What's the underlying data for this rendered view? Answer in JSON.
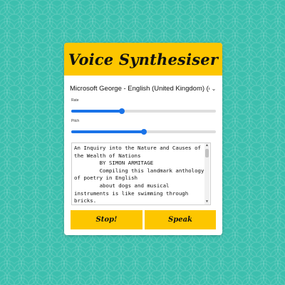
{
  "app": {
    "title": "Voice Synthesiser"
  },
  "voice": {
    "selected": "Microsoft George - English (United Kingdom) (en-GB)"
  },
  "rate": {
    "label": "Rate",
    "level": 0.35
  },
  "pitch": {
    "label": "Pitch",
    "level": 0.5
  },
  "text_input": {
    "value": "An Inquiry into the Nature and Causes of the Wealth of Nations\n        BY SIMON ARMITAGE\n        Compiling this landmark anthology of poetry in English\n        about dogs and musical instruments is like swimming through bricks."
  },
  "buttons": {
    "stop": "Stop!",
    "speak": "Speak"
  },
  "colors": {
    "accent": "#fdc600",
    "slider": "#1a73e8",
    "background": "#3cbfae"
  },
  "icons": {
    "select_caret": "chevron-down-icon",
    "scroll_up": "scroll-up-icon",
    "scroll_down": "scroll-down-icon"
  }
}
